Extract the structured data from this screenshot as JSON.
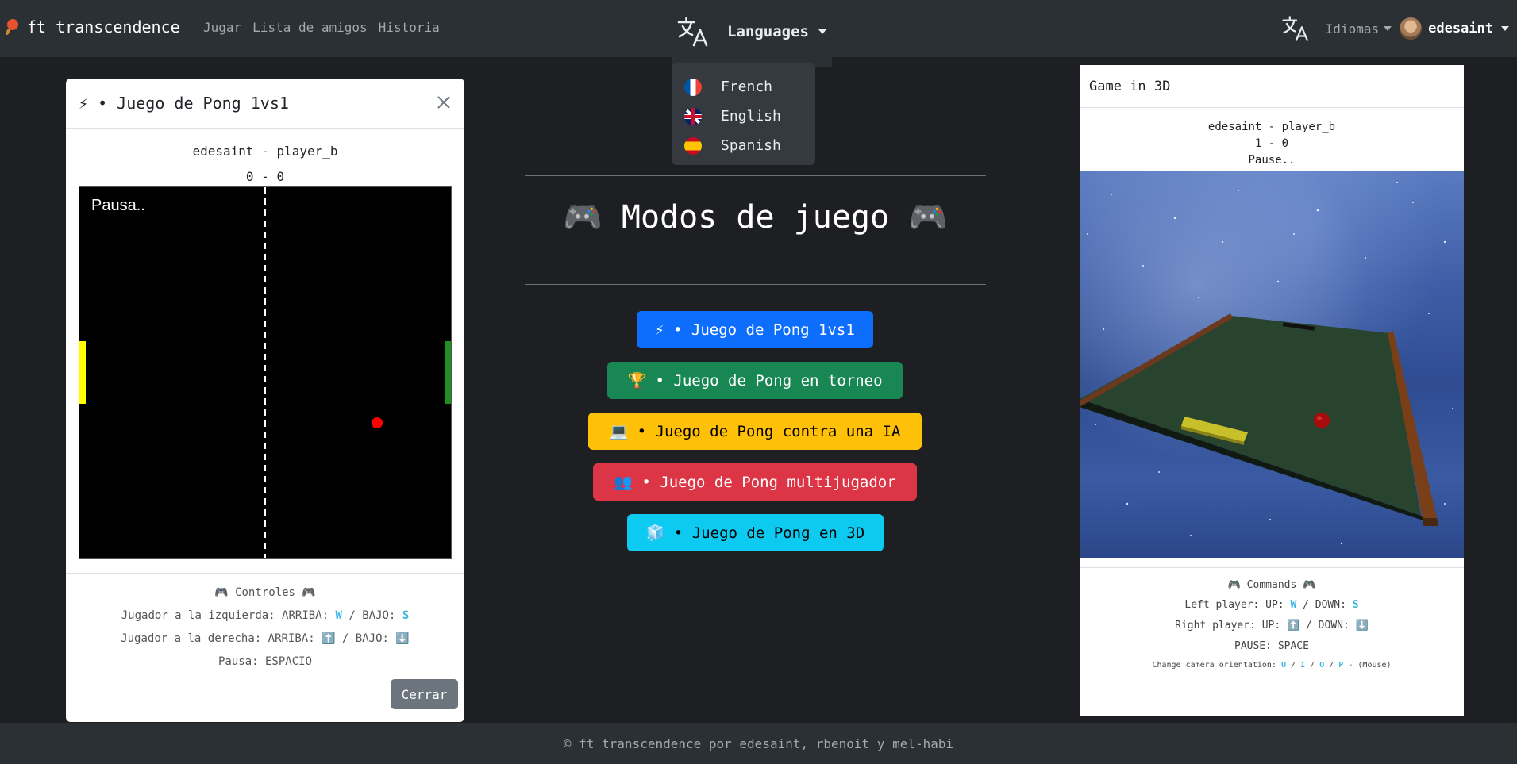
{
  "navbar": {
    "brand": "ft_transcendence",
    "links": [
      "Jugar",
      "Lista de amigos",
      "Historia"
    ],
    "language_label": "Languages",
    "idiomas_label": "Idiomas",
    "username": "edesaint",
    "icons": {
      "brand": "ping-pong-paddle-icon",
      "translate": "translate-icon"
    }
  },
  "language_dropdown": {
    "items": [
      {
        "label": "French",
        "flag": "flag-france-icon"
      },
      {
        "label": "English",
        "flag": "flag-uk-icon"
      },
      {
        "label": "Spanish",
        "flag": "flag-spain-icon"
      }
    ]
  },
  "left_modal": {
    "title": "⚡ • Juego de Pong 1vs1",
    "players": "edesaint - player_b",
    "score": "0 - 0",
    "pause_text": "Pausa..",
    "controls_title": "🎮 Controles 🎮",
    "left_player_prefix": "Jugador a la izquierda: ARRIBA:",
    "left_up_key": "W",
    "left_sep": "/ BAJO:",
    "left_down_key": "S",
    "right_player": "Jugador a la derecha: ARRIBA: ⬆️ / BAJO: ⬇️",
    "pause": "Pausa: ESPACIO",
    "close_button": "Cerrar",
    "colors": {
      "left_paddle": "#ffff00",
      "right_paddle": "#1f8f1f",
      "ball": "#ff0000"
    }
  },
  "center": {
    "title": "🎮 Modos de juego 🎮",
    "modes": [
      {
        "label": "⚡ • Juego de Pong 1vs1",
        "color": "#0d6efd"
      },
      {
        "label": "🏆 • Juego de Pong en torneo",
        "color": "#198754"
      },
      {
        "label": "💻 • Juego de Pong contra una IA",
        "color": "#ffc107"
      },
      {
        "label": "👥 • Juego de Pong multijugador",
        "color": "#dc3545"
      },
      {
        "label": "🧊 • Juego de Pong en 3D",
        "color": "#0dcaf0"
      }
    ]
  },
  "right_panel": {
    "title": "Game in 3D",
    "players": "edesaint - player_b",
    "score": "1 - 0",
    "status": "Pause..",
    "commands_title": "🎮 Commands 🎮",
    "left_prefix": "Left player: UP:",
    "left_up_key": "W",
    "left_sep": "/ DOWN:",
    "left_down_key": "S",
    "right_player": "Right player: UP: ⬆️ / DOWN: ⬇️",
    "pause": "PAUSE: SPACE",
    "camera_prefix": "Change camera orientation:",
    "camera_keys": [
      "U",
      "I",
      "O",
      "P"
    ],
    "camera_suffix": "- (Mouse)"
  },
  "footer": {
    "text": "© ft_transcendence por edesaint, rbenoit y mel-habi"
  }
}
